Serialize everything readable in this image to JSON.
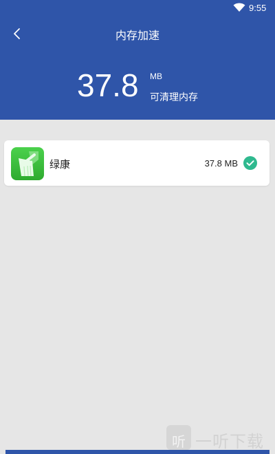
{
  "status_bar": {
    "time": "9:55",
    "wifi_icon": "wifi-icon"
  },
  "header": {
    "title": "内存加速",
    "back_icon": "chevron-left-icon",
    "amount": "37.8",
    "unit": "MB",
    "caption": "可清理内存"
  },
  "items": [
    {
      "name": "绿康",
      "size": "37.8 MB",
      "selected": true,
      "icon": "broom-icon"
    }
  ],
  "watermark": {
    "glyph": "听",
    "text": "一听下载"
  },
  "colors": {
    "header_bg": "#2f55a9",
    "page_bg": "#e6e6e6",
    "accent_check": "#2fb98f",
    "app_icon_green": "#3dbd3e"
  }
}
